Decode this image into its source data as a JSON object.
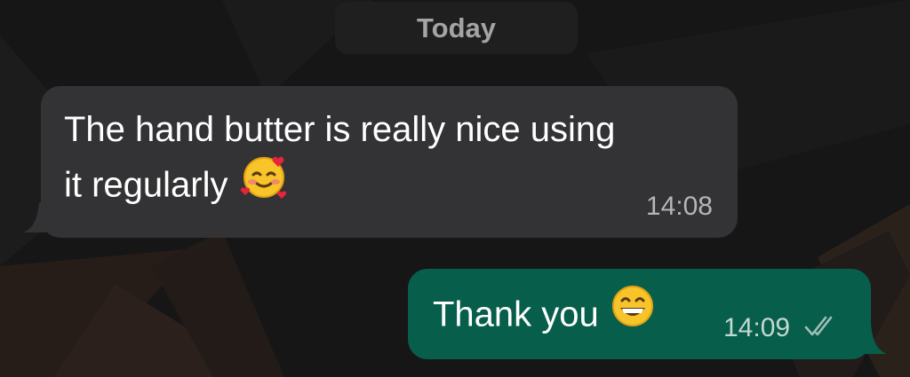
{
  "chat": {
    "date_label": "Today",
    "messages": [
      {
        "direction": "incoming",
        "line1": "The hand butter is really nice using",
        "line2": "it regularly",
        "emoji": "smiling-face-with-hearts",
        "time": "14:08"
      },
      {
        "direction": "outgoing",
        "text": "Thank you",
        "emoji": "grinning-face-with-smiling-eyes",
        "time": "14:09",
        "status_icon": "read-double-check-icon"
      }
    ]
  },
  "colors": {
    "background": "#161616",
    "incoming_bubble": "#333335",
    "outgoing_bubble": "#075e4b",
    "date_chip": "#1f1f1f",
    "text": "#ffffff",
    "timestamp": "#b5b5b5"
  }
}
